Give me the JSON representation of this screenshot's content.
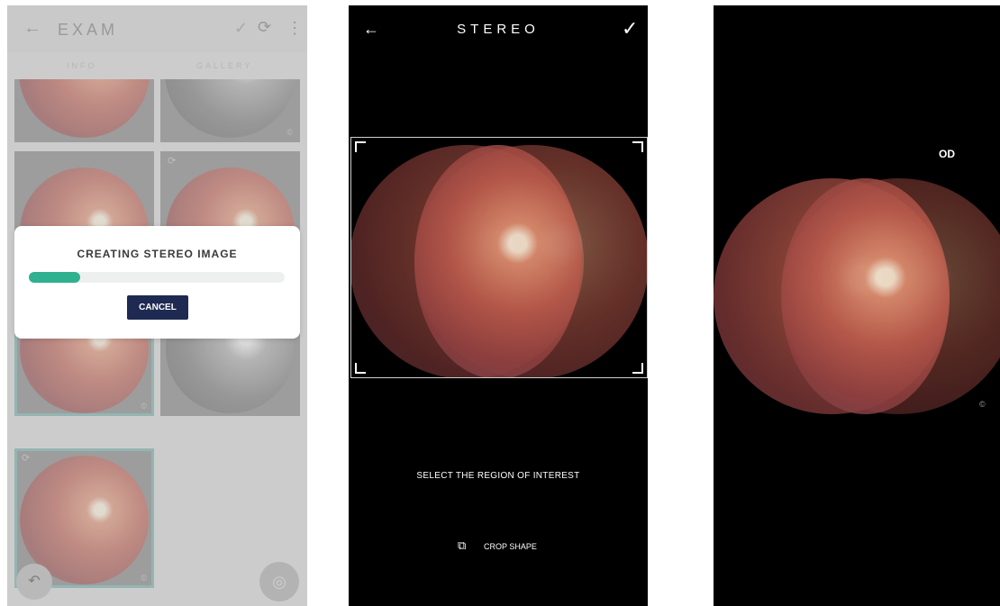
{
  "screen1": {
    "title": "EXAM",
    "back_icon": "←",
    "tabs": [
      "INFO",
      "GALLERY"
    ],
    "dialog": {
      "title": "CREATING STEREO IMAGE",
      "progress": 0.2,
      "cancel_label": "CANCEL"
    },
    "thumb_corner_label": "©",
    "colors": {
      "progress": "#2fb18f",
      "button": "#1e2a52",
      "selected_border": "#6aa7a0"
    }
  },
  "screen2": {
    "title": "STEREO",
    "back_icon": "←",
    "confirm_icon": "✓",
    "instruction": "SELECT THE REGION OF INTEREST",
    "crop_label": "CROP SHAPE"
  },
  "screen3": {
    "eye_label": "OD",
    "corner_label": "©"
  }
}
